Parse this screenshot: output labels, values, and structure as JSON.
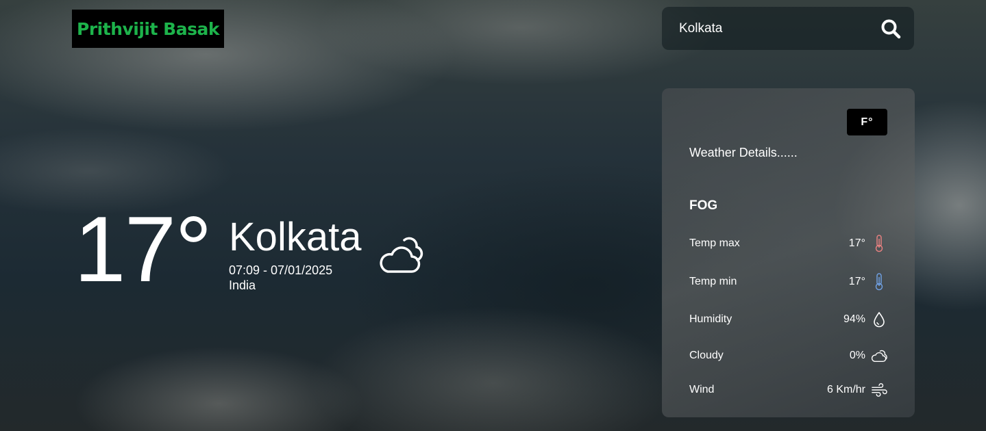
{
  "brand": {
    "name": "Prithvijit Basak",
    "color": "#1db34b"
  },
  "search": {
    "value": "Kolkata",
    "icon": "search-icon"
  },
  "current": {
    "temp": "17°",
    "city": "Kolkata",
    "datetime": "07:09 - 07/01/2025",
    "country": "India",
    "icon": "cloud-icon"
  },
  "details": {
    "unit_toggle": "F°",
    "title": "Weather Details......",
    "condition": "FOG",
    "rows": [
      {
        "label": "Temp max",
        "value": "17°",
        "icon": "thermometer-hot-icon"
      },
      {
        "label": "Temp min",
        "value": "17°",
        "icon": "thermometer-cold-icon"
      },
      {
        "label": "Humidity",
        "value": "94%",
        "icon": "droplet-icon"
      },
      {
        "label": "Cloudy",
        "value": "0%",
        "icon": "cloud-sun-icon"
      },
      {
        "label": "Wind",
        "value": "6 Km/hr",
        "icon": "wind-icon"
      }
    ]
  }
}
